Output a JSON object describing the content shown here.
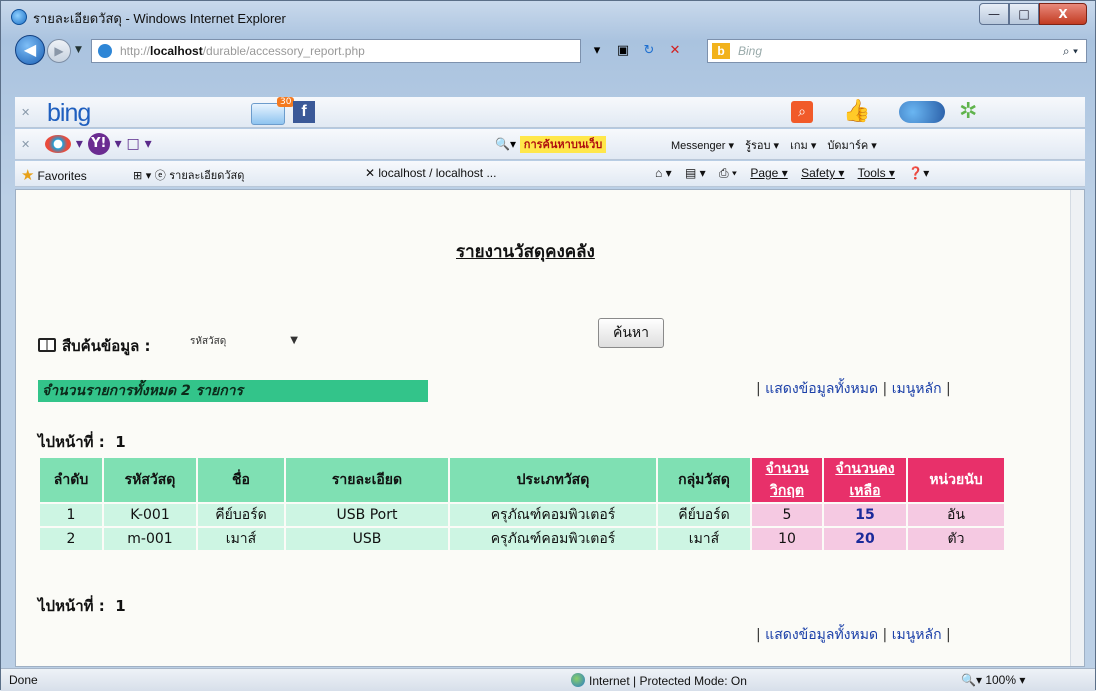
{
  "window": {
    "title": "รายละเอียดวัสดุ - Windows Internet Explorer",
    "minimize_label": "—",
    "maximize_label": "□",
    "close_label": "X"
  },
  "address": {
    "prefix": "http://",
    "host": "localhost",
    "path": "/durable/accessory_report.php",
    "search_placeholder": "Bing"
  },
  "toolbar1": {
    "bing_logo": "bing",
    "mail_count": "30",
    "fb_label": "f"
  },
  "toolbar2": {
    "search_label": "การค้นหาบนเว็บ",
    "links": [
      "Messenger ▾",
      "รู้รอบ ▾",
      "เกม ▾",
      "บัดมาร์ค ▾"
    ]
  },
  "toolbar3": {
    "favorites": "Favorites",
    "tab1": "รายละเอียดวัสดุ",
    "tab2": "localhost / localhost ...",
    "page_menu": "Page ▾",
    "safety_menu": "Safety ▾",
    "tools_menu": "Tools ▾"
  },
  "report": {
    "title": "รายงานวัสดุคงคลัง",
    "search_label": "สืบค้นข้อมูล :",
    "search_select_value": "รหัสวัสดุ",
    "search_button": "ค้นหา",
    "count_text": "จำนวนรายการทั้งหมด 2 รายการ",
    "show_all_link": "แสดงข้อมูลทั้งหมด",
    "main_menu_link": "เมนูหลัก",
    "goto_page_label": "ไปหน้าที่ :",
    "goto_page_value": "1"
  },
  "table": {
    "headers": [
      "ลำดับ",
      "รหัสวัสดุ",
      "ชื่อ",
      "รายละเอียด",
      "ประเภทวัสดุ",
      "กลุ่มวัสดุ",
      "จำนวนวิกฤต",
      "จำนวนคงเหลือ",
      "หน่วยนับ"
    ],
    "rows": [
      [
        "1",
        "K-001",
        "คีย์บอร์ด",
        "USB Port",
        "ครุภัณฑ์คอมพิวเตอร์",
        "คีย์บอร์ด",
        "5",
        "15",
        "อัน"
      ],
      [
        "2",
        "m-001",
        "เมาส์",
        "USB",
        "ครุภัณฑ์คอมพิวเตอร์",
        "เมาส์",
        "10",
        "20",
        "ตัว"
      ]
    ]
  },
  "status": {
    "left": "Done",
    "zone": "Internet | Protected Mode: On",
    "zoom": "100%"
  },
  "colors": {
    "header_green": "#7fe0b3",
    "header_pink": "#e8306a",
    "count_bar": "#33c48a",
    "link_blue": "#1a3fa8"
  }
}
